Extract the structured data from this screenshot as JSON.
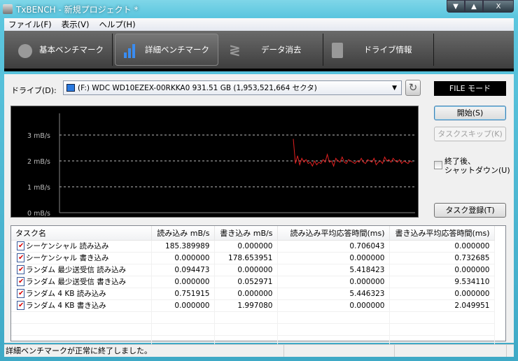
{
  "window": {
    "title": "TxBENCH - 新規プロジェクト *",
    "min": "▼",
    "max": "▲",
    "close": "X"
  },
  "menu": [
    "ファイル(F)",
    "表示(V)",
    "ヘルプ(H)"
  ],
  "tabs": [
    {
      "label": "基本ベンチマーク",
      "icon": "stopwatch-icon"
    },
    {
      "label": "詳細ベンチマーク",
      "icon": "bar-chart-icon",
      "active": true
    },
    {
      "label": "データ消去",
      "icon": "spring-icon"
    },
    {
      "label": "ドライブ情報",
      "icon": "drive-info-icon"
    }
  ],
  "drive": {
    "label": "ドライブ(D):",
    "value": "(F:) WDC WD10EZEX-00RKKA0  931.51 GB (1,953,521,664 セクタ)",
    "mode": "FILE モード"
  },
  "buttons": {
    "start": "開始(S)",
    "skip": "タスクスキップ(K)",
    "shutdown": "終了後、\nシャットダウン(U)",
    "register": "タスク登録(T)"
  },
  "chart_data": {
    "type": "line",
    "yticks": [
      "0 mB/s",
      "1 mB/s",
      "2 mB/s",
      "3 mB/s"
    ],
    "ylim": [
      0,
      3.9
    ],
    "grid": true,
    "color": "#e02020",
    "values": [
      2.85,
      1.9,
      2.2,
      1.85,
      2.1,
      1.95,
      2.05,
      1.9,
      1.95,
      1.8,
      2.0,
      1.85,
      1.95,
      1.9,
      2.05,
      1.95,
      2.25,
      1.95,
      2.0,
      1.8,
      2.1,
      2.0,
      1.95,
      2.15,
      1.95,
      1.9,
      2.05,
      2.0,
      1.95,
      1.9,
      2.0,
      1.95,
      2.1,
      1.95,
      1.9,
      2.05,
      2.0,
      1.95,
      2.1,
      1.85,
      1.95,
      2.0,
      1.9,
      2.15,
      2.0,
      2.05,
      1.95,
      2.1,
      2.0,
      1.95,
      2.05,
      1.9,
      2.0,
      1.95,
      1.9,
      2.0,
      1.95
    ]
  },
  "table": {
    "headers": [
      "タスク名",
      "読み込み mB/s",
      "書き込み mB/s",
      "読み込み平均応答時間(ms)",
      "書き込み平均応答時間(ms)"
    ],
    "rows": [
      [
        "シーケンシャル 読み込み",
        "185.389989",
        "0.000000",
        "0.706043",
        "0.000000"
      ],
      [
        "シーケンシャル 書き込み",
        "0.000000",
        "178.653951",
        "0.000000",
        "0.732685"
      ],
      [
        "ランダム 最少送受信 読み込み",
        "0.094473",
        "0.000000",
        "5.418423",
        "0.000000"
      ],
      [
        "ランダム 最少送受信 書き込み",
        "0.000000",
        "0.052971",
        "0.000000",
        "9.534110"
      ],
      [
        "ランダム 4 KB 読み込み",
        "0.751915",
        "0.000000",
        "5.446323",
        "0.000000"
      ],
      [
        "ランダム 4 KB 書き込み",
        "0.000000",
        "1.997080",
        "0.000000",
        "2.049951"
      ]
    ]
  },
  "status": "詳細ベンチマークが正常に終了しました。"
}
